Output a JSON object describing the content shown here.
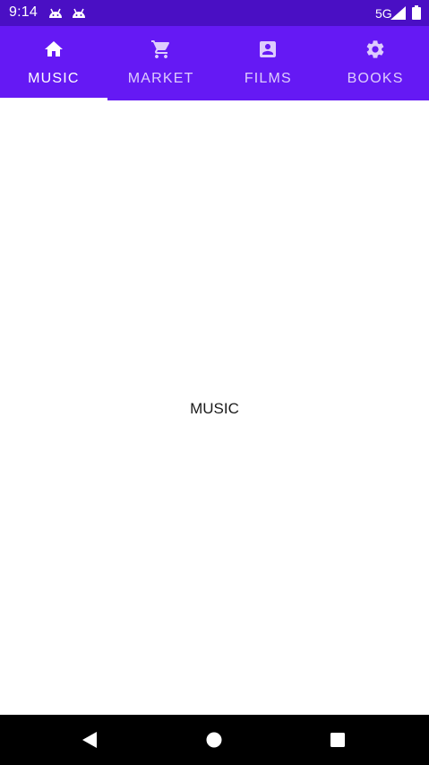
{
  "status_bar": {
    "time": "9:14",
    "network": "5G",
    "icons": [
      "android-notification-icon",
      "android-notification-icon",
      "signal-icon",
      "battery-icon"
    ]
  },
  "tabs": [
    {
      "label": "MUSIC",
      "icon": "home-icon",
      "active": true
    },
    {
      "label": "MARKET",
      "icon": "shopping-cart-icon",
      "active": false
    },
    {
      "label": "FILMS",
      "icon": "contact-card-icon",
      "active": false
    },
    {
      "label": "BOOKS",
      "icon": "gear-icon",
      "active": false
    }
  ],
  "content": {
    "page_label": "MUSIC"
  },
  "nav_bar": {
    "buttons": [
      "back-icon",
      "home-circle-icon",
      "recents-square-icon"
    ]
  },
  "colors": {
    "status_bar": "#4a0fc4",
    "tab_bar": "#6519f4",
    "indicator": "#ffffff",
    "nav_bar": "#000000"
  }
}
